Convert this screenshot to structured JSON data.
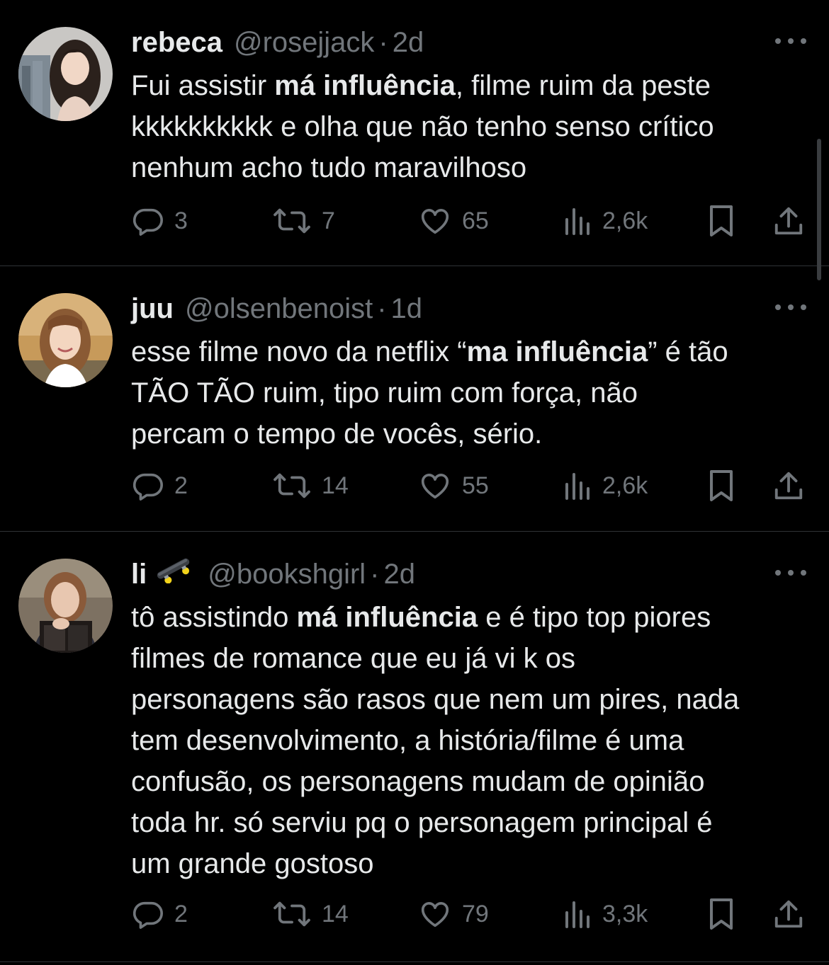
{
  "tweets": [
    {
      "name": "rebeca",
      "name_emoji": "",
      "handle": "@rosejjack",
      "separator": "·",
      "time": "2d",
      "lines": [
        [
          [
            "Fui assistir ",
            false
          ],
          [
            "má influência",
            true
          ],
          [
            ", filme ruim da peste",
            false
          ]
        ],
        [
          [
            "kkkkkkkkkk e olha que não tenho senso crítico",
            false
          ]
        ],
        [
          [
            "nenhum acho tudo maravilhoso",
            false
          ]
        ]
      ],
      "replies": "3",
      "retweets": "7",
      "likes": "65",
      "views": "2,6k"
    },
    {
      "name": "juu",
      "name_emoji": "",
      "handle": "@olsenbenoist",
      "separator": "·",
      "time": "1d",
      "lines": [
        [
          [
            "esse filme novo da netflix “",
            false
          ],
          [
            "ma influência",
            true
          ],
          [
            "” é tão",
            false
          ]
        ],
        [
          [
            "TÃO TÃO ruim, tipo ruim com força, não",
            false
          ]
        ],
        [
          [
            "percam o tempo de vocês, sério.",
            false
          ]
        ]
      ],
      "replies": "2",
      "retweets": "14",
      "likes": "55",
      "views": "2,6k"
    },
    {
      "name": "li",
      "name_emoji": "🛹",
      "handle": "@bookshgirl",
      "separator": "·",
      "time": "2d",
      "lines": [
        [
          [
            "tô assistindo ",
            false
          ],
          [
            "má influência",
            true
          ],
          [
            " e é tipo top piores",
            false
          ]
        ],
        [
          [
            "filmes de romance que eu já vi k os",
            false
          ]
        ],
        [
          [
            "personagens são rasos que nem um pires, nada",
            false
          ]
        ],
        [
          [
            "tem desenvolvimento, a história/filme é uma",
            false
          ]
        ],
        [
          [
            "confusão, os personagens mudam de opinião",
            false
          ]
        ],
        [
          [
            "toda hr. só serviu pq o personagem principal é",
            false
          ]
        ],
        [
          [
            "um grande gostoso",
            false
          ]
        ]
      ],
      "replies": "2",
      "retweets": "14",
      "likes": "79",
      "views": "3,3k"
    }
  ],
  "icons": {
    "reply": "reply-icon",
    "retweet": "retweet-icon",
    "like": "heart-icon",
    "views": "views-icon",
    "bookmark": "bookmark-icon",
    "share": "share-icon",
    "more": "more-icon"
  },
  "colors": {
    "background": "#000000",
    "text": "#e7e9ea",
    "muted": "#71767b",
    "divider": "#2f3336"
  }
}
